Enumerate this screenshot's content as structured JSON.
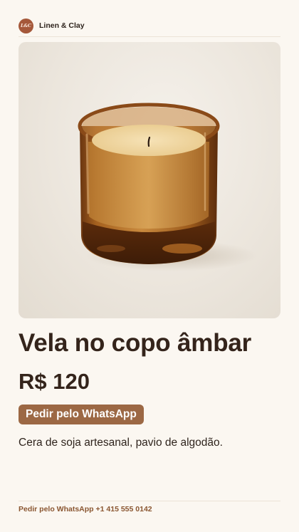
{
  "header": {
    "logo_text": "L&C",
    "brand_name": "Linen & Clay"
  },
  "product": {
    "image_icon": "amber-candle-jar-image",
    "title": "Vela no copo âmbar",
    "price": "R$ 120",
    "cta_label": "Pedir pelo WhatsApp",
    "description": "Cera de soja artesanal, pavio de algodão."
  },
  "footer": {
    "text": "Pedir pelo WhatsApp +1 415 555 0142"
  },
  "colors": {
    "background": "#fbf7f1",
    "accent": "#9c6844",
    "logo": "#a5583a",
    "footer_text": "#8a5631"
  }
}
